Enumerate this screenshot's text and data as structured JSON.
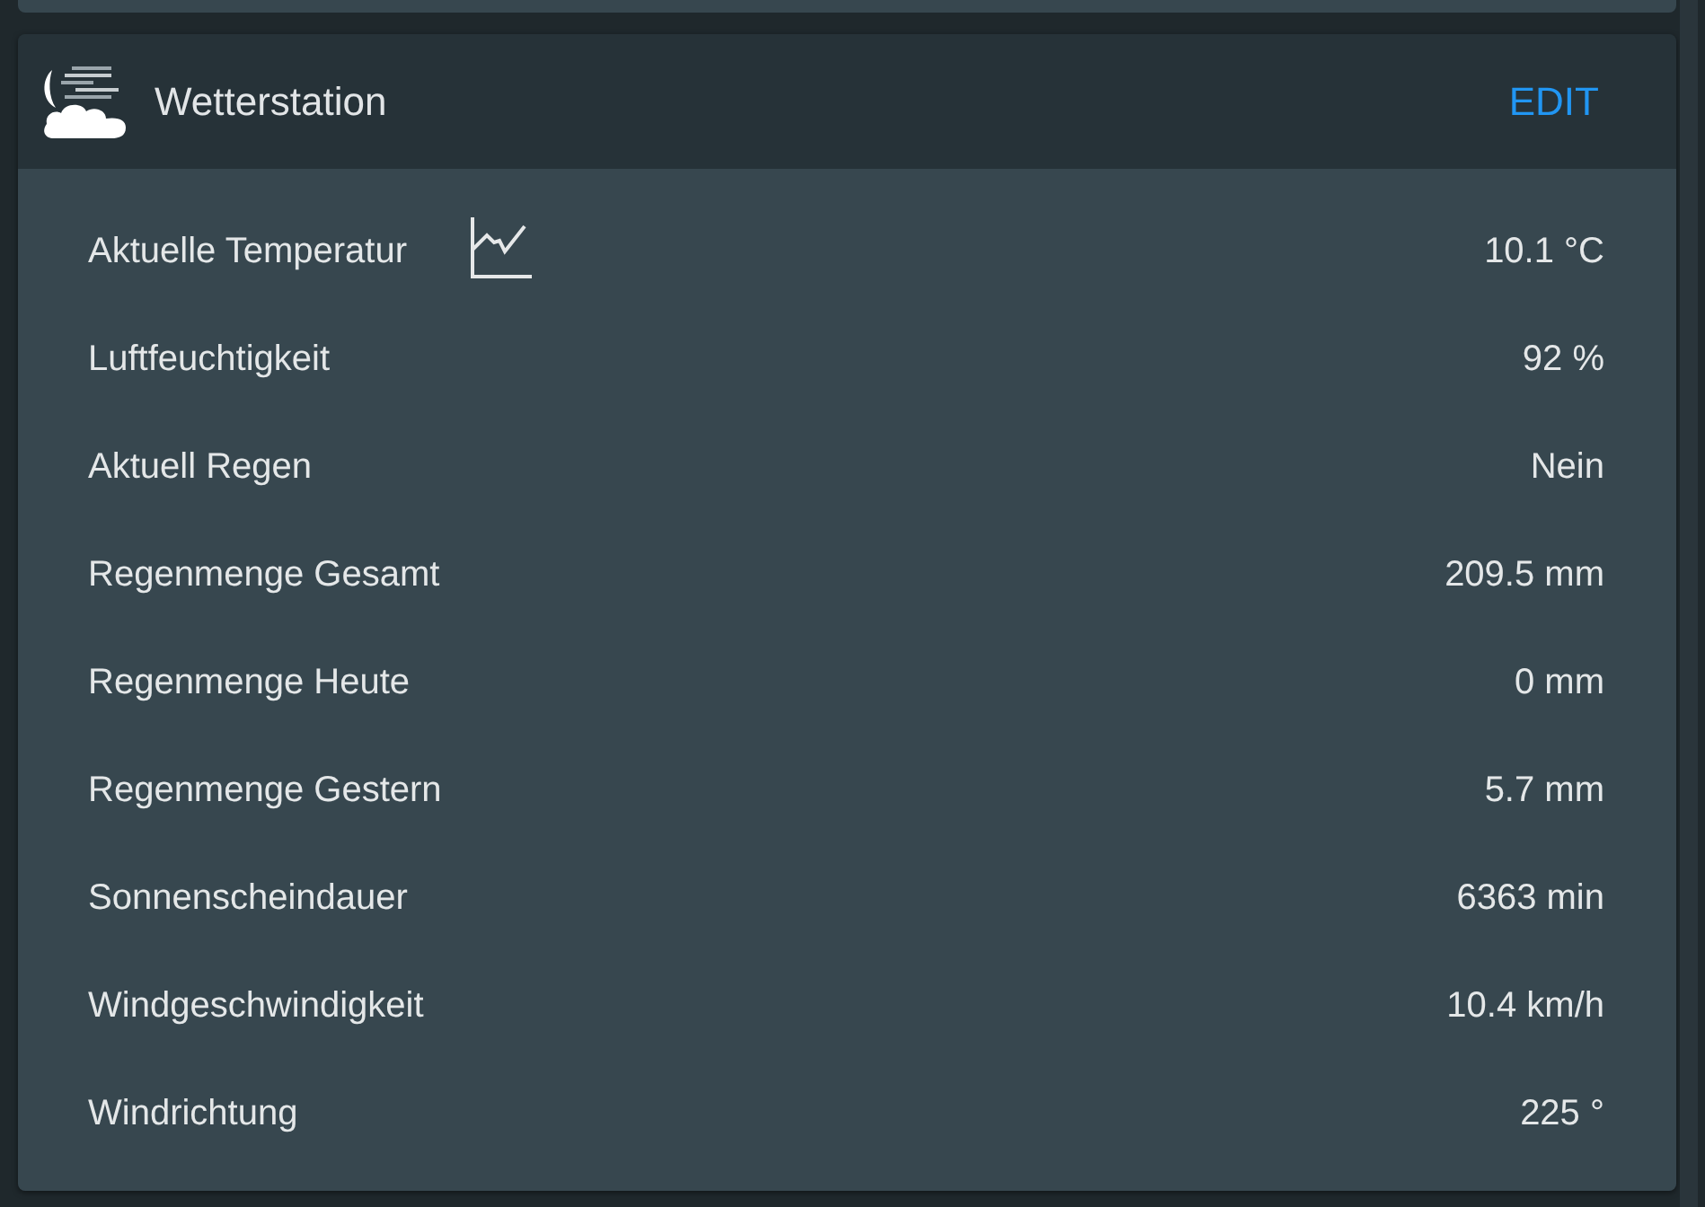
{
  "card": {
    "title": "Wetterstation",
    "action": "EDIT",
    "rows": [
      {
        "label": "Aktuelle Temperatur",
        "value": "10.1 °C",
        "kind": "chart"
      },
      {
        "label": "Luftfeuchtigkeit",
        "value": "92 %",
        "kind": "plain"
      },
      {
        "label": "Aktuell Regen",
        "value": "Nein",
        "kind": "plain"
      },
      {
        "label": "Regenmenge Gesamt",
        "value": "209.5 mm",
        "kind": "plain"
      },
      {
        "label": "Regenmenge Heute",
        "value": "0 mm",
        "kind": "plain"
      },
      {
        "label": "Regenmenge Gestern",
        "value": "5.7 mm",
        "kind": "plain"
      },
      {
        "label": "Sonnenscheindauer",
        "value": "6363 min",
        "kind": "plain"
      },
      {
        "label": "Windgeschwindigkeit",
        "value": "10.4 km/h",
        "kind": "plain"
      },
      {
        "label": "Windrichtung",
        "value": "225 °",
        "kind": "plain"
      }
    ]
  }
}
